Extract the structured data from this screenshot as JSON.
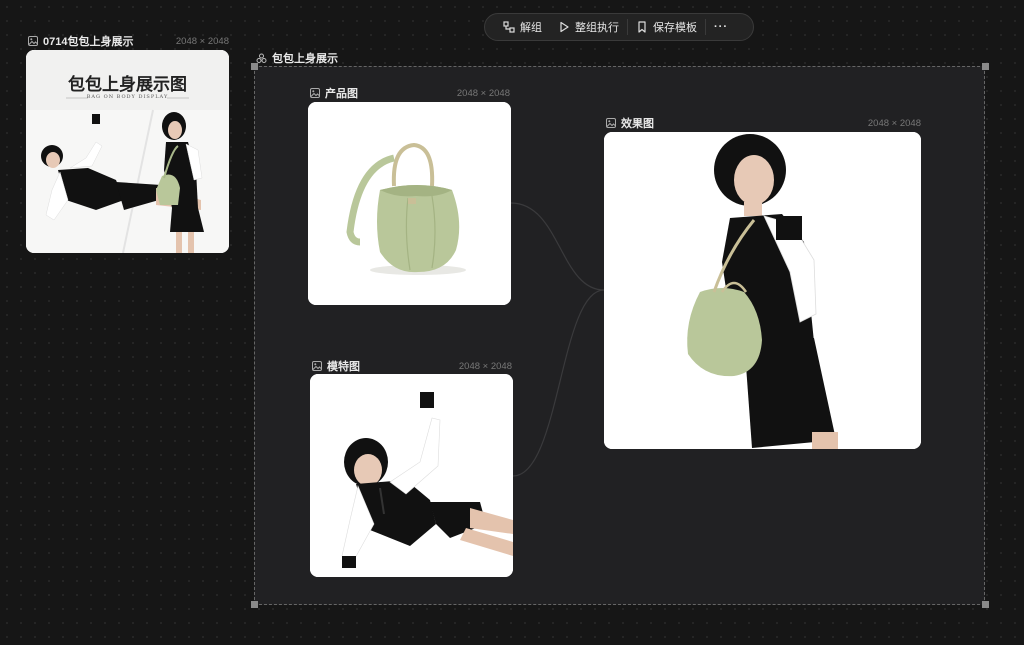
{
  "toolbar": {
    "ungroup_label": "解组",
    "run_group_label": "整组执行",
    "save_template_label": "保存模板",
    "more_label": "···"
  },
  "preview_node": {
    "title": "0714包包上身展示",
    "dimensions": "2048 × 2048",
    "headline": "包包上身展示图",
    "subline": "BAG ON BODY DISPLAY"
  },
  "group": {
    "title": "包包上身展示"
  },
  "product_node": {
    "title": "产品图",
    "dimensions": "2048 × 2048"
  },
  "model_node": {
    "title": "模特图",
    "dimensions": "2048 × 2048"
  },
  "result_node": {
    "title": "效果图",
    "dimensions": "2048 × 2048"
  },
  "icons": [
    "ungroup-icon",
    "play-icon",
    "bookmark-icon",
    "more-icon",
    "image-icon",
    "group-icon"
  ],
  "colors": {
    "canvas": "#161616",
    "group_bg": "#212123",
    "bag": "#b9c79a",
    "accent_text": "#e8e8e8"
  }
}
